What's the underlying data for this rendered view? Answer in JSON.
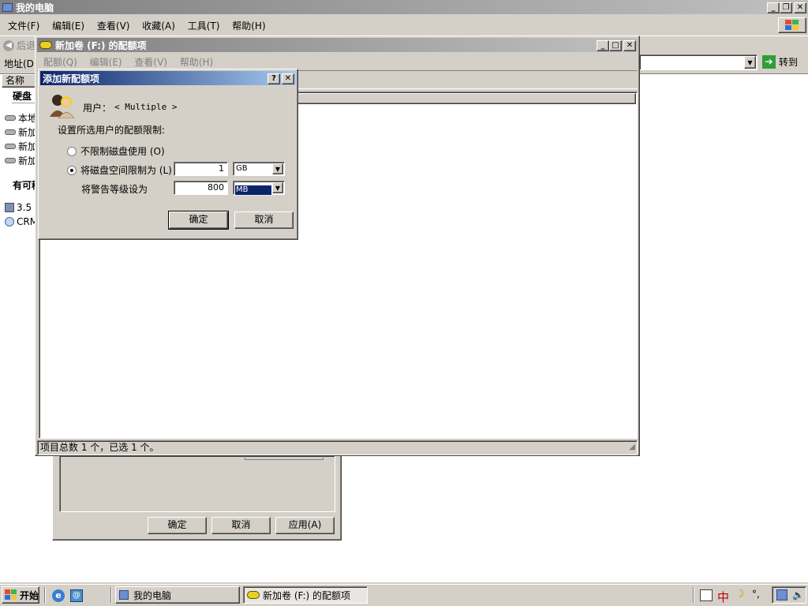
{
  "main_window": {
    "title": "我的电脑",
    "menu": [
      "文件(F)",
      "编辑(E)",
      "查看(V)",
      "收藏(A)",
      "工具(T)",
      "帮助(H)"
    ],
    "back_label": "后退",
    "address_label": "地址(D)",
    "go_label": "转到",
    "column_name": "名称",
    "section_hdd": "硬盘",
    "section_removable": "有可移",
    "drives": [
      "本地",
      "新加",
      "新加",
      "新加"
    ],
    "removable": [
      "3.5",
      "CRM"
    ]
  },
  "props_dialog": {
    "ok_label": "确定",
    "cancel_label": "取消",
    "apply_label": "应用(A)"
  },
  "quota_window": {
    "title": "新加卷 (F:) 的配额项",
    "menu": [
      "配额(Q)",
      "编辑(E)",
      "查看(V)",
      "帮助(H)"
    ],
    "status": "项目总数 1 个，已选 1 个。"
  },
  "add_quota_dialog": {
    "title": "添加新配额项",
    "user_label": "用户：",
    "user_value": "< Multiple >",
    "instruction": "设置所选用户的配额限制:",
    "no_limit_label": "不限制磁盘使用 (O)",
    "limit_label": "将磁盘空间限制为 (L)",
    "limit_value": "1",
    "limit_unit": "GB",
    "warning_label": "将警告等级设为",
    "warning_value": "800",
    "warning_unit": "MB",
    "ok_label": "确定",
    "cancel_label": "取消"
  },
  "taskbar": {
    "start_label": "开始",
    "task_my_computer": "我的电脑",
    "task_quota": "新加卷 (F:) 的配额项",
    "tray_ime": "中",
    "tray_symbols": "°,"
  }
}
